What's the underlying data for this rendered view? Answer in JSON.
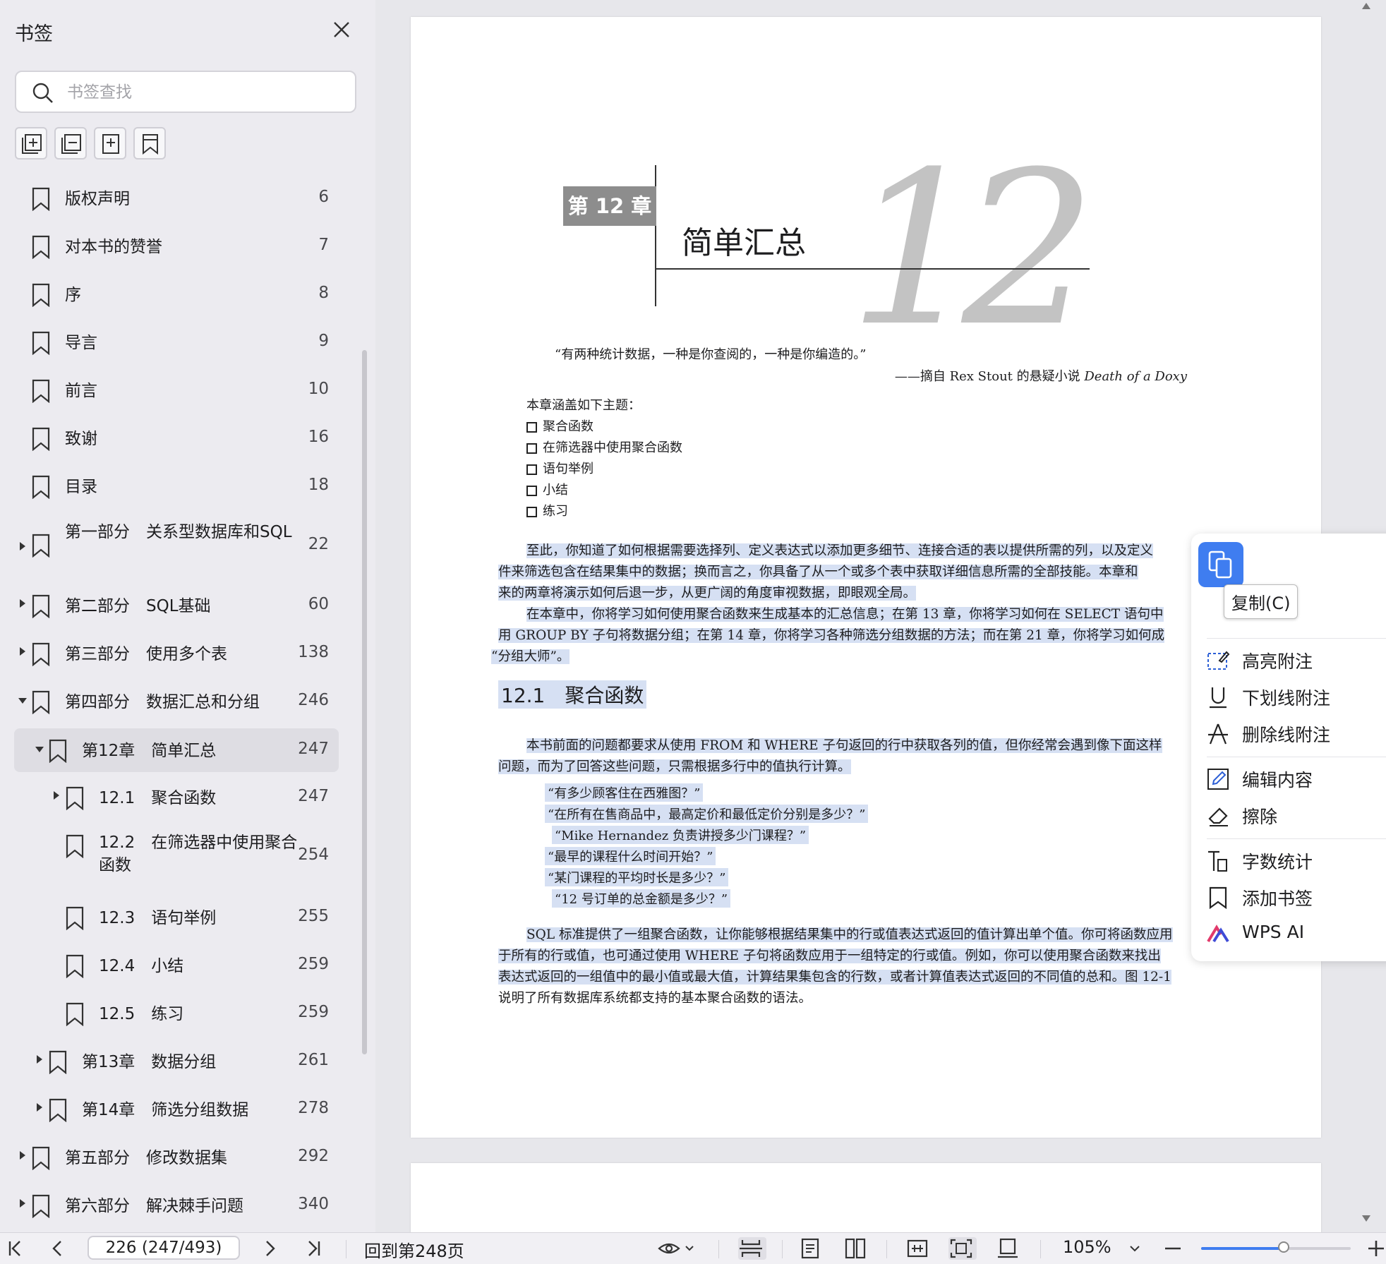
{
  "sidebar": {
    "title": "书签",
    "search_placeholder": "书签查找",
    "items": [
      {
        "label": "版权声明",
        "page": "6"
      },
      {
        "label": "对本书的赞誉",
        "page": "7"
      },
      {
        "label": "序",
        "page": "8"
      },
      {
        "label": "导言",
        "page": "9"
      },
      {
        "label": "前言",
        "page": "10"
      },
      {
        "label": "致谢",
        "page": "16"
      },
      {
        "label": "目录",
        "page": "18"
      },
      {
        "label": "第一部分　关系型数据库和SQL",
        "page": "22"
      },
      {
        "label": "第二部分　SQL基础",
        "page": "60"
      },
      {
        "label": "第三部分　使用多个表",
        "page": "138"
      },
      {
        "label": "第四部分　数据汇总和分组",
        "page": "246"
      },
      {
        "label": "第12章　简单汇总",
        "page": "247"
      },
      {
        "label": "12.1　聚合函数",
        "page": "247"
      },
      {
        "label": "12.2　在筛选器中使用聚合函数",
        "page": "254"
      },
      {
        "label": "12.3　语句举例",
        "page": "255"
      },
      {
        "label": "12.4　小结",
        "page": "259"
      },
      {
        "label": "12.5　练习",
        "page": "259"
      },
      {
        "label": "第13章　数据分组",
        "page": "261"
      },
      {
        "label": "第14章　筛选分组数据",
        "page": "278"
      },
      {
        "label": "第五部分　修改数据集",
        "page": "292"
      },
      {
        "label": "第六部分　解决棘手问题",
        "page": "340"
      }
    ]
  },
  "document": {
    "chapter_tag": "第 12 章",
    "chapter_title": "简单汇总",
    "chapter_number": "12",
    "epigraph": "“有两种统计数据，一种是你查阅的，一种是你编造的。”",
    "epigraph_source_prefix": "——摘自 Rex Stout 的悬疑小说",
    "epigraph_source_title": "Death of a Doxy",
    "topics_intro": "本章涵盖如下主题：",
    "topics": [
      "聚合函数",
      "在筛选器中使用聚合函数",
      "语句举例",
      "小结",
      "练习"
    ],
    "para1": [
      "至此，你知道了如何根据需要选择列、定义表达式以添加更多细节、连接合适的表以提供所需的列，以及定义",
      "件来筛选包含在结果集中的数据；换而言之，你具备了从一个或多个表中获取详细信息所需的全部技能。本章和",
      "来的两章将演示如何后退一步，从更广阔的角度审视数据，即眼观全局。"
    ],
    "para2": [
      "在本章中，你将学习如何使用聚合函数来生成基本的汇总信息；在第 13 章，你将学习如何在 SELECT 语句中",
      "用 GROUP BY 子句将数据分组；在第 14 章，你将学习各种筛选分组数据的方法；而在第 21 章，你将学习如何成",
      "“分组大师”。"
    ],
    "section_heading": "12.1　聚合函数",
    "para3": [
      "本书前面的问题都要求从使用 FROM 和 WHERE 子句返回的行中获取各列的值，但你经常会遇到像下面这样",
      "问题，而为了回答这些问题，只需根据多行中的值执行计算。"
    ],
    "questions": [
      "“有多少顾客住在西雅图？”",
      "“在所有在售商品中，最高定价和最低定价分别是多少？”",
      "“Mike Hernandez 负责讲授多少门课程？”",
      "“最早的课程什么时间开始？”",
      "“某门课程的平均时长是多少？”",
      "“12 号订单的总金额是多少？”"
    ],
    "para4": [
      "SQL 标准提供了一组聚合函数，让你能够根据结果集中的行或值表达式返回的值计算出单个值。你可将函数应用",
      "于所有的行或值，也可通过使用 WHERE 子句将函数应用于一组特定的行或值。例如，你可以使用聚合函数来找出",
      "表达式返回的一组值中的最小值或最大值，计算结果集包含的行数，或者计算值表达式返回的不同值的总和。图 12-1",
      "说明了所有数据库系统都支持的基本聚合函数的语法。"
    ]
  },
  "context_menu": {
    "copy_tooltip": "复制(C)",
    "items": [
      {
        "label": "高亮附注",
        "icon": "highlight-icon"
      },
      {
        "label": "下划线附注",
        "icon": "underline-icon"
      },
      {
        "label": "删除线附注",
        "icon": "strikethrough-icon"
      },
      {
        "label": "编辑内容",
        "icon": "edit-icon"
      },
      {
        "label": "擦除",
        "icon": "eraser-icon"
      },
      {
        "label": "字数统计",
        "icon": "word-count-icon"
      },
      {
        "label": "添加书签",
        "icon": "bookmark-icon"
      },
      {
        "label": "WPS AI",
        "icon": "wps-ai-icon"
      }
    ]
  },
  "status_bar": {
    "page_value": "226 (247/493)",
    "goto_label": "回到第248页",
    "zoom_label": "105%",
    "zoom_fraction": 0.55
  }
}
